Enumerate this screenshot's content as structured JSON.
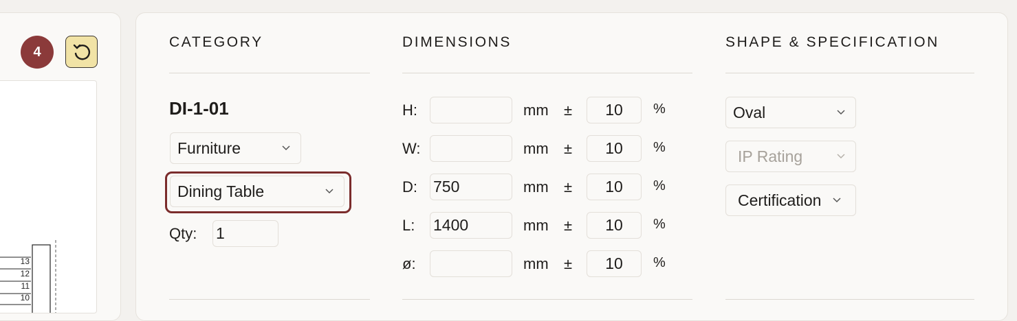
{
  "left_panel": {
    "count_badge": "4",
    "drawing_numbers": [
      "13",
      "12",
      "11",
      "10"
    ]
  },
  "category": {
    "title": "CATEGORY",
    "code": "DI-1-01",
    "type_select": "Furniture",
    "subtype_select": "Dining Table",
    "qty_label": "Qty:",
    "qty_value": "1"
  },
  "dimensions": {
    "title": "DIMENSIONS",
    "unit": "mm",
    "plus_minus": "±",
    "percent": "%",
    "rows": [
      {
        "label": "H:",
        "value": "",
        "tolerance": "10"
      },
      {
        "label": "W:",
        "value": "",
        "tolerance": "10"
      },
      {
        "label": "D:",
        "value": "750",
        "tolerance": "10"
      },
      {
        "label": "L:",
        "value": "1400",
        "tolerance": "10"
      },
      {
        "label": "ø:",
        "value": "",
        "tolerance": "10"
      }
    ]
  },
  "shape_spec": {
    "title": "SHAPE & SPECIFICATION",
    "shape_select": "Oval",
    "ip_rating_select": "IP Rating",
    "certification_select": "Certification"
  },
  "colors": {
    "accent": "#8b3a3a",
    "focus": "#7b2c2c",
    "reset_bg": "#f1e3a6"
  }
}
